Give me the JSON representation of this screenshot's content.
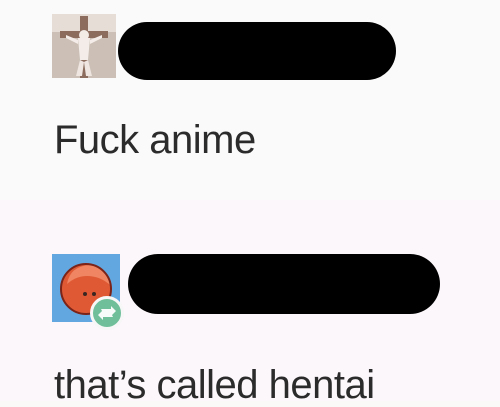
{
  "posts": [
    {
      "text": "Fuck anime",
      "avatar_icon": "crucifix-avatar-icon",
      "username_redacted": true
    },
    {
      "text": "that’s called hentai",
      "avatar_icon": "character-face-avatar-icon",
      "badge_icon": "reblog-icon",
      "username_redacted": true
    }
  ],
  "colors": {
    "background": "#fbf8f8",
    "text": "#2b2b2b",
    "redaction": "#000000",
    "avatar_blue": "#62a7e0",
    "avatar_orange": "#e35d37",
    "reblog_green": "#6fbf9a"
  }
}
